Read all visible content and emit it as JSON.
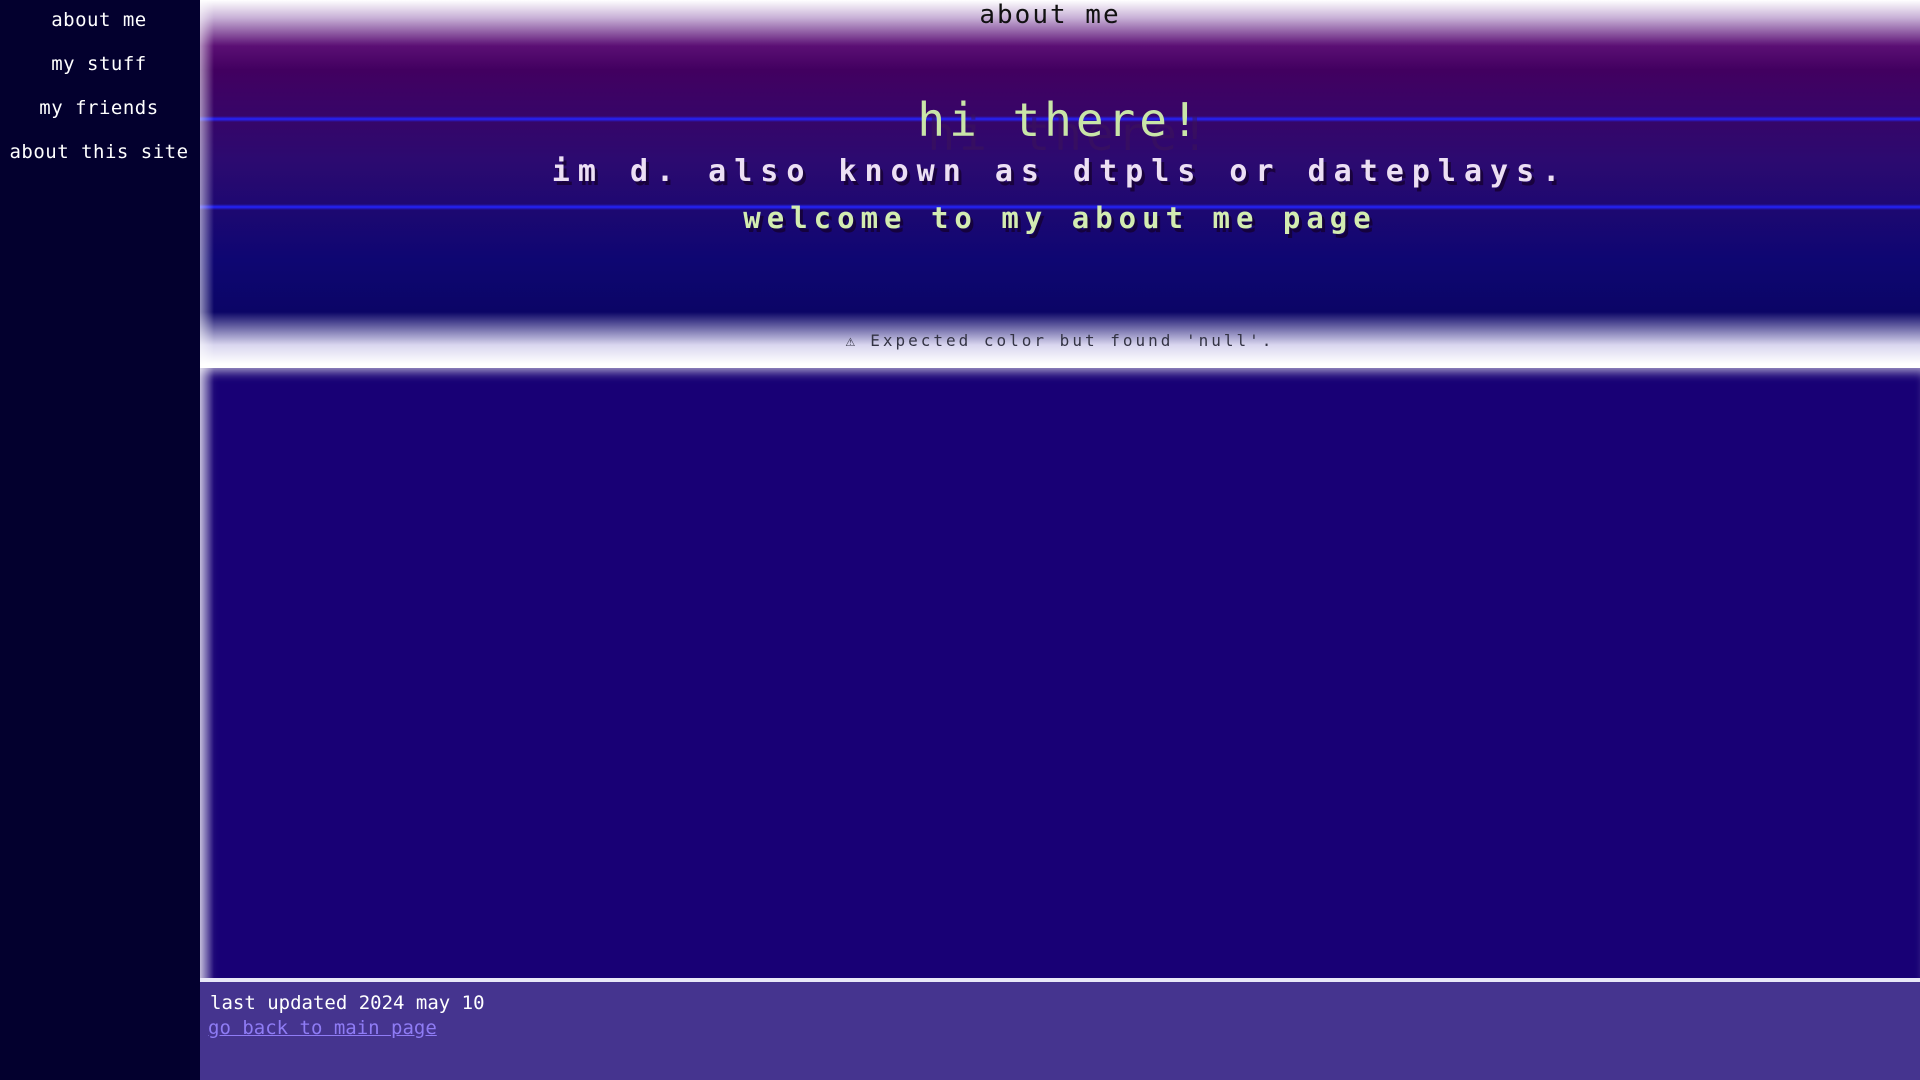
{
  "sidebar": {
    "items": [
      {
        "label": "about me"
      },
      {
        "label": "my stuff"
      },
      {
        "label": "my friends"
      },
      {
        "label": "about this site"
      }
    ]
  },
  "header": {
    "title": "about me",
    "hello": "hi there!",
    "intro": "im d. also known as dtpls or dateplays.",
    "welcome": "welcome to my about me page",
    "warning_icon": "warning-icon",
    "warning": "Expected color but found 'null'."
  },
  "footer": {
    "updated": "last updated 2024 may 10",
    "back_link": "go back to main page"
  },
  "colors": {
    "sidebar_bg": "#03002e",
    "content_bg": "#180075",
    "footer_bg": "#45348f",
    "accent_text": "#c9e5a8",
    "link": "#8f7cf5"
  }
}
